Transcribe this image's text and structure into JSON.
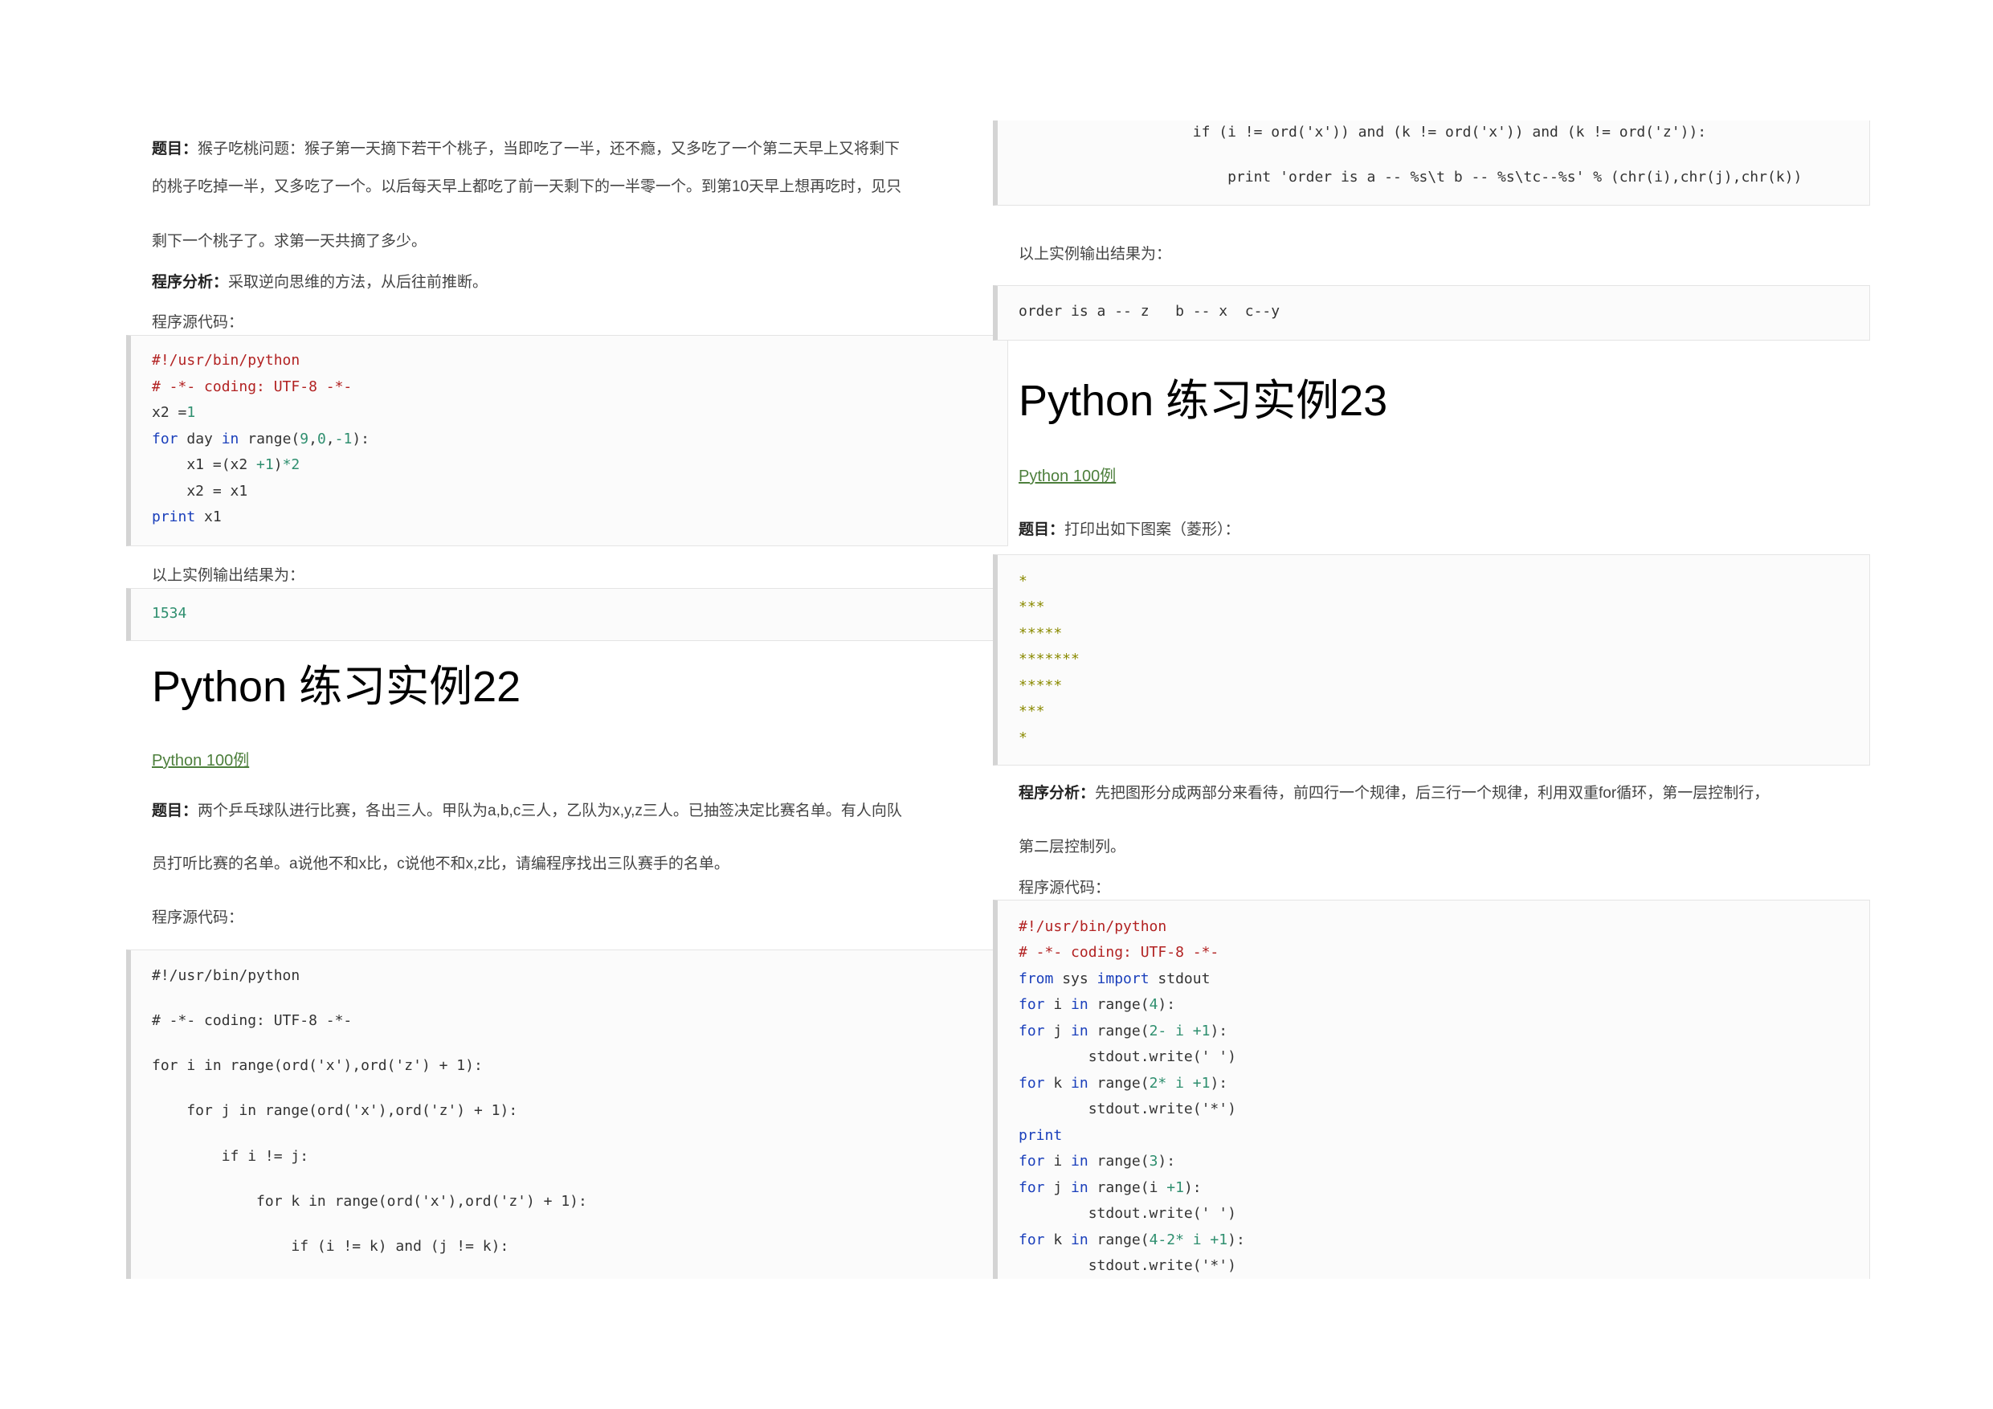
{
  "left": {
    "p1": {
      "label": "题目：",
      "line1": "猴子吃桃问题：猴子第一天摘下若干个桃子，当即吃了一半，还不瘾，又多吃了一个第二天早上又将剩下",
      "line2a": "的桃子吃掉一半，又多吃了一个。以后每天早上都吃了前一天剩下的一半零一个。到第",
      "line2num": "10",
      "line2b": "天早上想再吃时，见只",
      "line3": "剩下一个桃子了。求第一天共摘了多少。"
    },
    "p2": {
      "label": "程序分析：",
      "text": "采取逆向思维的方法，从后往前推断。"
    },
    "src_label": "程序源代码：",
    "code1": {
      "l1": "#!/usr/bin/python",
      "l2": "# -*- coding: UTF-8 -*-",
      "l3a": "x2 =",
      "l3b": "1",
      "l4a": "for",
      "l4b": " day ",
      "l4c": "in",
      "l4d": " range(",
      "l4e": "9",
      "l4f": ",",
      "l4g": "0",
      "l4h": ",",
      "l4i": "-1",
      "l4j": "):",
      "l5a": "    x1 =(x2 ",
      "l5b": "+1",
      "l5c": ")",
      "l5d": "*2",
      "l6": "    x2 = x1",
      "l7a": "print",
      "l7b": " x1"
    },
    "out_label": "以上实例输出结果为：",
    "out1": "1534",
    "heading22": "Python 练习实例22",
    "link22": "Python 100例",
    "p3": {
      "label": "题目：",
      "line1a": "两个乒乓球队进行比赛，各出三人。甲队为",
      "line1b": "a,b,c",
      "line1c": "三人，乙队为",
      "line1d": "x,y,z",
      "line1e": "三人。已抽签决定比赛名单。有人向队",
      "line2a": "员打听比赛的名单。",
      "line2b": "a",
      "line2c": "说他不和",
      "line2d": "x",
      "line2e": "比，",
      "line2f": "c",
      "line2g": "说他不和",
      "line2h": "x,z",
      "line2i": "比，请编程序找出三队赛手的名单。"
    },
    "src_label2": "程序源代码：",
    "code2": [
      "#!/usr/bin/python",
      "# -*- coding: UTF-8 -*-",
      "for i in range(ord('x'),ord('z') + 1):",
      "    for j in range(ord('x'),ord('z') + 1):",
      "        if i != j:",
      "            for k in range(ord('x'),ord('z') + 1):",
      "                if (i != k) and (j != k):"
    ]
  },
  "right": {
    "code0": [
      "                    if (i != ord('x')) and (k != ord('x')) and (k != ord('z')):",
      "                        print 'order is a -- %s\\t b -- %s\\tc--%s' % (chr(i),chr(j),chr(k))"
    ],
    "out_label": "以上实例输出结果为：",
    "out0": "order is a -- z   b -- x  c--y",
    "heading23": "Python 练习实例23",
    "link23": "Python 100例",
    "p4": {
      "label": "题目：",
      "text": "打印出如下图案（菱形）："
    },
    "stars": [
      "*",
      "***",
      "*****",
      "*******",
      "*****",
      "***",
      "*"
    ],
    "p5": {
      "label": "程序分析：",
      "line1a": "先把图形分成两部分来看待，前四行一个规律，后三行一个规律，利用双重",
      "line1b": "for",
      "line1c": "循环，第一层控制行，",
      "line2": "第二层控制列。"
    },
    "src_label": "程序源代码：",
    "code3": {
      "l1": "#!/usr/bin/python",
      "l2": "# -*- coding: UTF-8 -*-",
      "l3a": "from",
      "l3b": " sys ",
      "l3c": "import",
      "l3d": " stdout",
      "l4a": "for",
      "l4b": " i ",
      "l4c": "in",
      "l4d": " range(",
      "l4e": "4",
      "l4f": "):",
      "l5a": "for",
      "l5b": " j ",
      "l5c": "in",
      "l5d": " range(",
      "l5e": "2- i +1",
      "l5f": "):",
      "l6": "        stdout.write(' ')",
      "l7a": "for",
      "l7b": " k ",
      "l7c": "in",
      "l7d": " range(",
      "l7e": "2* i +1",
      "l7f": "):",
      "l8": "        stdout.write('*')",
      "l9": "print",
      "l10a": "for",
      "l10b": " i ",
      "l10c": "in",
      "l10d": " range(",
      "l10e": "3",
      "l10f": "):",
      "l11a": "for",
      "l11b": " j ",
      "l11c": "in",
      "l11d": " range(i ",
      "l11e": "+1",
      "l11f": "):",
      "l12": "        stdout.write(' ')",
      "l13a": "for",
      "l13b": " k ",
      "l13c": "in",
      "l13d": " range(",
      "l13e": "4-2* i +1",
      "l13f": "):",
      "l14": "        stdout.write('*')"
    }
  }
}
